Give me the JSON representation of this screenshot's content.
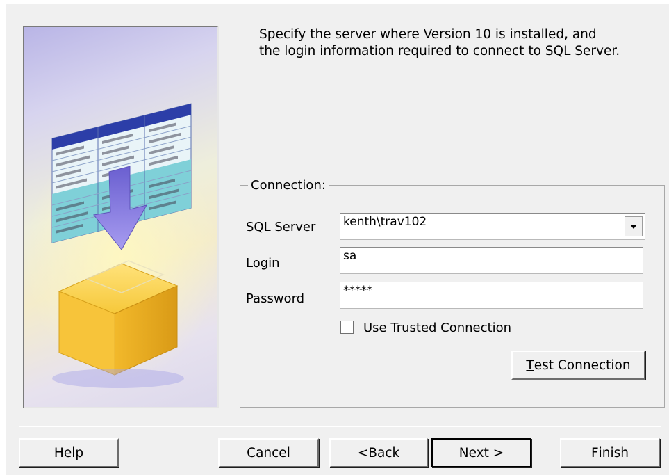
{
  "intro_text": "Specify the server where Version 10 is installed, and the login information required to connect to SQL Server.",
  "connection": {
    "legend": "Connection:",
    "sql_server": {
      "label": "SQL Server",
      "value": "kenth\\trav102"
    },
    "login": {
      "label": "Login",
      "value": "sa"
    },
    "password": {
      "label": "Password",
      "value": "*****"
    },
    "trusted": {
      "label": "Use Trusted Connection",
      "checked": false
    },
    "test_button": {
      "prefix": "",
      "mnemonic": "T",
      "rest": "est Connection"
    }
  },
  "buttons": {
    "help": "Help",
    "cancel": "Cancel",
    "back": {
      "prefix": "< ",
      "mnemonic": "B",
      "rest": "ack"
    },
    "next": {
      "prefix": "",
      "mnemonic": "N",
      "rest": "ext >"
    },
    "finish": {
      "prefix": "",
      "mnemonic": "F",
      "rest": "inish"
    }
  },
  "icons": [
    "database-table-illustration",
    "arrow-down-icon",
    "database-cube-illustration",
    "chevron-down-icon",
    "checkbox-icon"
  ],
  "colors": {
    "dialog_bg": "#f0f0f0",
    "cube": "#f2c12e",
    "arrow": "#7f72d6",
    "table_header": "#2c3ea8",
    "table_body": "#7fd0d8"
  }
}
